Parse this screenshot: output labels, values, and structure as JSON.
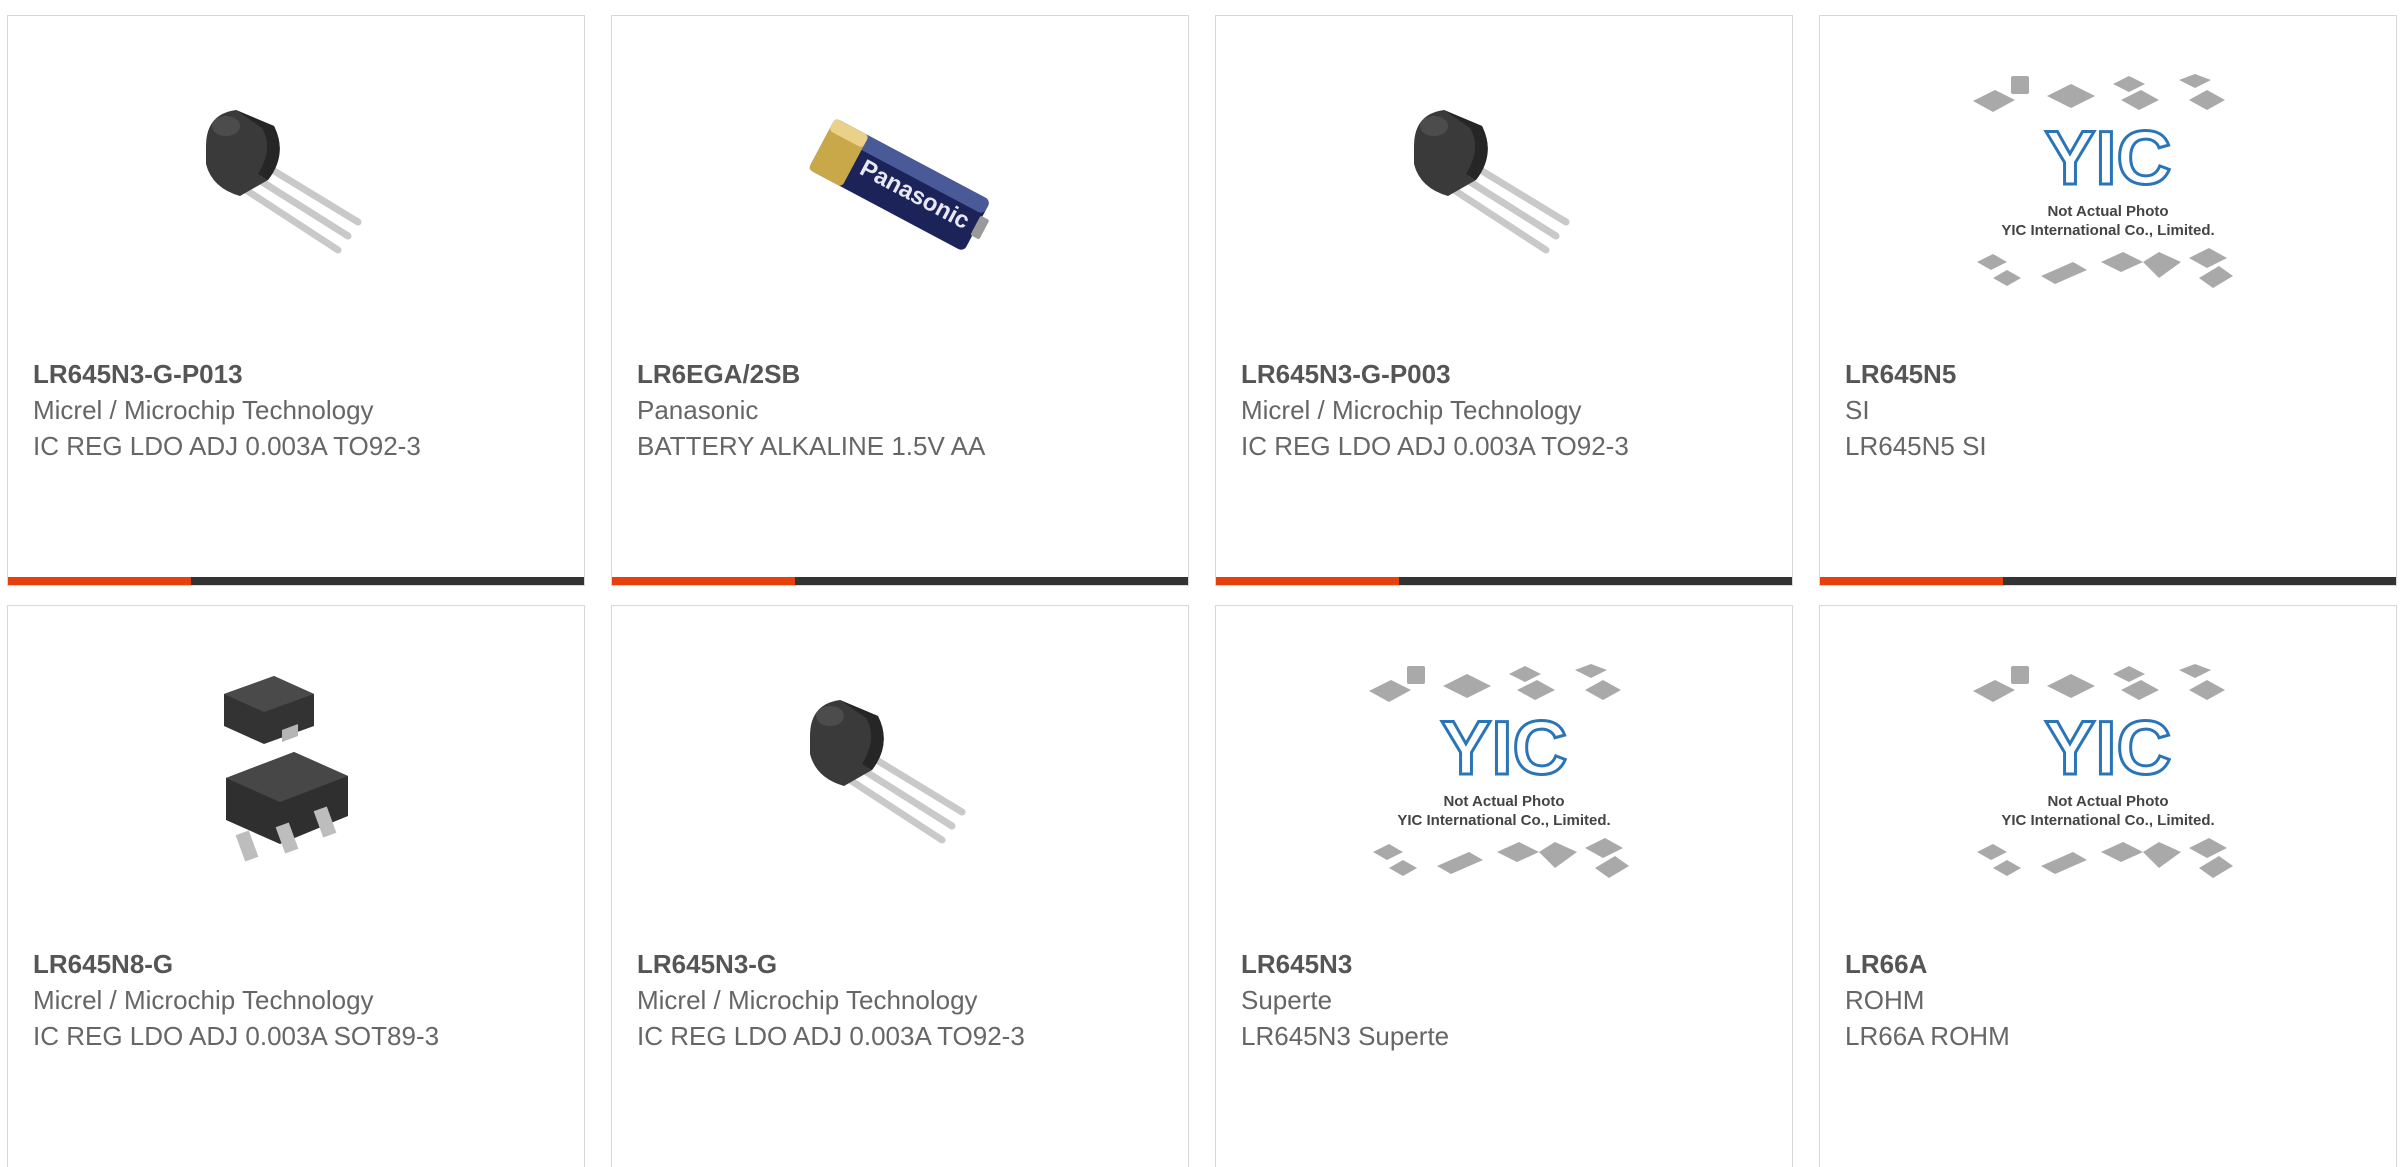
{
  "products": [
    {
      "part": "LR645N3-G-P013",
      "maker": "Micrel / Microchip Technology",
      "desc": "IC REG LDO ADJ 0.003A TO92-3",
      "image": "to92-transistor-icon"
    },
    {
      "part": "LR6EGA/2SB",
      "maker": "Panasonic",
      "desc": "BATTERY ALKALINE 1.5V AA",
      "image": "aa-battery-icon",
      "image_text": "Panasonic"
    },
    {
      "part": "LR645N3-G-P003",
      "maker": "Micrel / Microchip Technology",
      "desc": "IC REG LDO ADJ 0.003A TO92-3",
      "image": "to92-transistor-icon"
    },
    {
      "part": "LR645N5",
      "maker": "SI",
      "desc": "LR645N5 SI",
      "image": "placeholder-photo-icon",
      "placeholder_logo": "YIC",
      "placeholder_line1": "Not Actual Photo",
      "placeholder_line2": "YIC International Co., Limited."
    },
    {
      "part": "LR645N8-G",
      "maker": "Micrel / Microchip Technology",
      "desc": "IC REG LDO ADJ 0.003A SOT89-3",
      "image": "sot89-package-icon"
    },
    {
      "part": "LR645N3-G",
      "maker": "Micrel / Microchip Technology",
      "desc": "IC REG LDO ADJ 0.003A TO92-3",
      "image": "to92-transistor-icon"
    },
    {
      "part": "LR645N3",
      "maker": "Superte",
      "desc": "LR645N3 Superte",
      "image": "placeholder-photo-icon",
      "placeholder_logo": "YIC",
      "placeholder_line1": "Not Actual Photo",
      "placeholder_line2": "YIC International Co., Limited."
    },
    {
      "part": "LR66A",
      "maker": "ROHM",
      "desc": "LR66A ROHM",
      "image": "placeholder-photo-icon",
      "placeholder_logo": "YIC",
      "placeholder_line1": "Not Actual Photo",
      "placeholder_line2": "YIC International Co., Limited."
    }
  ],
  "colors": {
    "accent": "#e8400c",
    "bar": "#333333",
    "border": "#d8d8d8",
    "text": "#666666"
  }
}
